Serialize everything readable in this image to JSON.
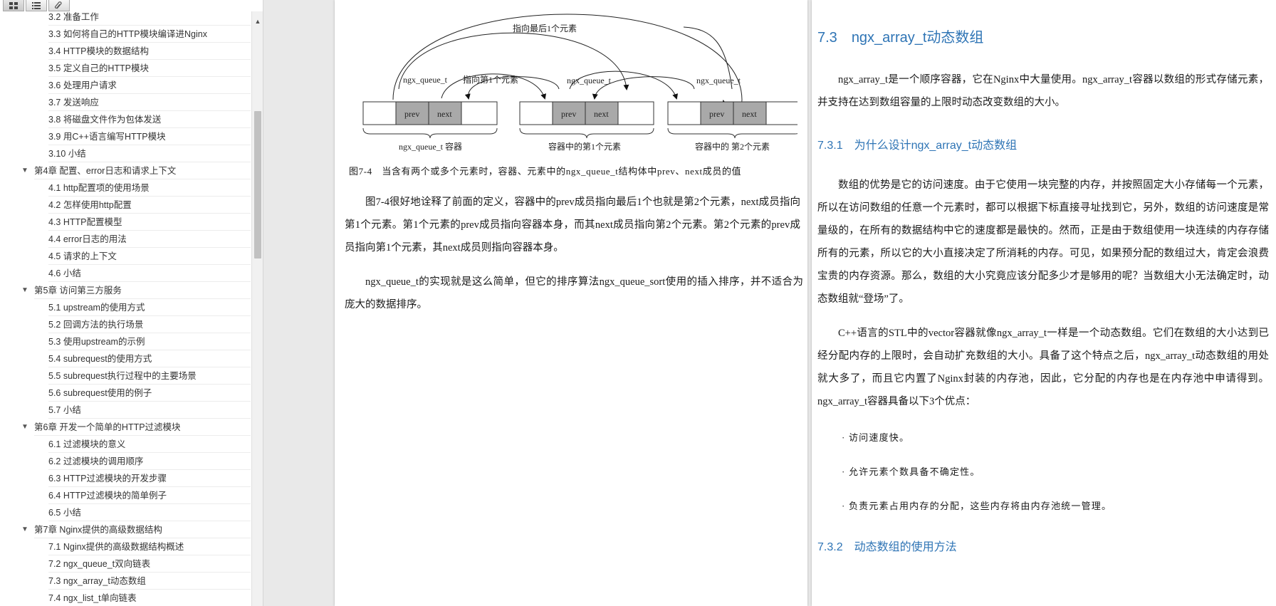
{
  "toolbar": {
    "buttons": [
      {
        "icon": "thumbnails-icon",
        "label": ""
      },
      {
        "icon": "outline-list-icon",
        "label": ""
      },
      {
        "icon": "attachment-icon",
        "label": ""
      }
    ]
  },
  "toc": {
    "items": [
      {
        "type": "sec",
        "label": "3.2 准备工作"
      },
      {
        "type": "sec",
        "label": "3.3 如何将自己的HTTP模块编译进Nginx"
      },
      {
        "type": "sec",
        "label": "3.4 HTTP模块的数据结构"
      },
      {
        "type": "sec",
        "label": "3.5 定义自己的HTTP模块"
      },
      {
        "type": "sec",
        "label": "3.6 处理用户请求"
      },
      {
        "type": "sec",
        "label": "3.7 发送响应"
      },
      {
        "type": "sec",
        "label": "3.8 将磁盘文件作为包体发送"
      },
      {
        "type": "sec",
        "label": "3.9 用C++语言编写HTTP模块"
      },
      {
        "type": "sec",
        "label": "3.10 小结"
      },
      {
        "type": "ch",
        "label": "第4章 配置、error日志和请求上下文"
      },
      {
        "type": "sec",
        "label": "4.1 http配置项的使用场景"
      },
      {
        "type": "sec",
        "label": "4.2 怎样使用http配置"
      },
      {
        "type": "sec",
        "label": "4.3 HTTP配置模型"
      },
      {
        "type": "sec",
        "label": "4.4 error日志的用法"
      },
      {
        "type": "sec",
        "label": "4.5 请求的上下文"
      },
      {
        "type": "sec",
        "label": "4.6 小结"
      },
      {
        "type": "ch",
        "label": "第5章 访问第三方服务"
      },
      {
        "type": "sec",
        "label": "5.1 upstream的使用方式"
      },
      {
        "type": "sec",
        "label": "5.2 回调方法的执行场景"
      },
      {
        "type": "sec",
        "label": "5.3 使用upstream的示例"
      },
      {
        "type": "sec",
        "label": "5.4 subrequest的使用方式"
      },
      {
        "type": "sec",
        "label": "5.5 subrequest执行过程中的主要场景"
      },
      {
        "type": "sec",
        "label": "5.6 subrequest使用的例子"
      },
      {
        "type": "sec",
        "label": "5.7 小结"
      },
      {
        "type": "ch",
        "label": "第6章 开发一个简单的HTTP过滤模块"
      },
      {
        "type": "sec",
        "label": "6.1 过滤模块的意义"
      },
      {
        "type": "sec",
        "label": "6.2 过滤模块的调用顺序"
      },
      {
        "type": "sec",
        "label": "6.3 HTTP过滤模块的开发步骤"
      },
      {
        "type": "sec",
        "label": "6.4 HTTP过滤模块的简单例子"
      },
      {
        "type": "sec",
        "label": "6.5 小结"
      },
      {
        "type": "ch",
        "label": "第7章 Nginx提供的高级数据结构"
      },
      {
        "type": "sec",
        "label": "7.1 Nginx提供的高级数据结构概述"
      },
      {
        "type": "sec",
        "label": "7.2 ngx_queue_t双向链表"
      },
      {
        "type": "sec",
        "label": "7.3 ngx_array_t动态数组"
      },
      {
        "type": "sec",
        "label": "7.4 ngx_list_t单向链表"
      }
    ]
  },
  "left_page": {
    "diagram": {
      "top_arc_label": "指向最后1个元素",
      "arrow_label_1": "ngx_queue_t",
      "arrow_label_1b": "指向第1个元素",
      "arrow_label_2": "ngx_queue_t",
      "arrow_label_3": "ngx_queue_t",
      "prev": "prev",
      "next": "next",
      "box_label_1": "ngx_queue_t 容器",
      "box_label_2": "容器中的第1个元素",
      "box_label_3": "容器中的 第2个元素"
    },
    "caption": "图7-4　当含有两个或多个元素时，容器、元素中的ngx_queue_t结构体中prev、next成员的值",
    "para1": "图7-4很好地诠释了前面的定义，容器中的prev成员指向最后1个也就是第2个元素，next成员指向第1个元素。第1个元素的prev成员指向容器本身，而其next成员指向第2个元素。第2个元素的prev成员指向第1个元素，其next成员则指向容器本身。",
    "para2": "ngx_queue_t的实现就是这么简单，但它的排序算法ngx_queue_sort使用的插入排序，并不适合为庞大的数据排序。"
  },
  "right_page": {
    "h2_num": "7.3",
    "h2_title": "ngx_array_t动态数组",
    "para1": "ngx_array_t是一个顺序容器，它在Nginx中大量使用。ngx_array_t容器以数组的形式存储元素，并支持在达到数组容量的上限时动态改变数组的大小。",
    "h3a_num": "7.3.1",
    "h3a_title": "为什么设计ngx_array_t动态数组",
    "para2": "数组的优势是它的访问速度。由于它使用一块完整的内存，并按照固定大小存储每一个元素，所以在访问数组的任意一个元素时，都可以根据下标直接寻址找到它，另外，数组的访问速度是常量级的，在所有的数据结构中它的速度都是最快的。然而，正是由于数组使用一块连续的内存存储所有的元素，所以它的大小直接决定了所消耗的内存。可见，如果预分配的数组过大，肯定会浪费宝贵的内存资源。那么，数组的大小究竟应该分配多少才是够用的呢？当数组大小无法确定时，动态数组就“登场”了。",
    "para3": "C++语言的STL中的vector容器就像ngx_array_t一样是一个动态数组。它们在数组的大小达到已经分配内存的上限时，会自动扩充数组的大小。具备了这个特点之后，ngx_array_t动态数组的用处就大多了，而且它内置了Nginx封装的内存池，因此，它分配的内存也是在内存池中申请得到。ngx_array_t容器具备以下3个优点：",
    "bullets": [
      "· 访问速度快。",
      "· 允许元素个数具备不确定性。",
      "· 负责元素占用内存的分配，这些内存将由内存池统一管理。"
    ],
    "h3b_num": "7.3.2",
    "h3b_title": "动态数组的使用方法"
  },
  "colors": {
    "heading": "#2e74b5",
    "body_text": "#1a1a1a",
    "sidebar_text": "#333333"
  }
}
